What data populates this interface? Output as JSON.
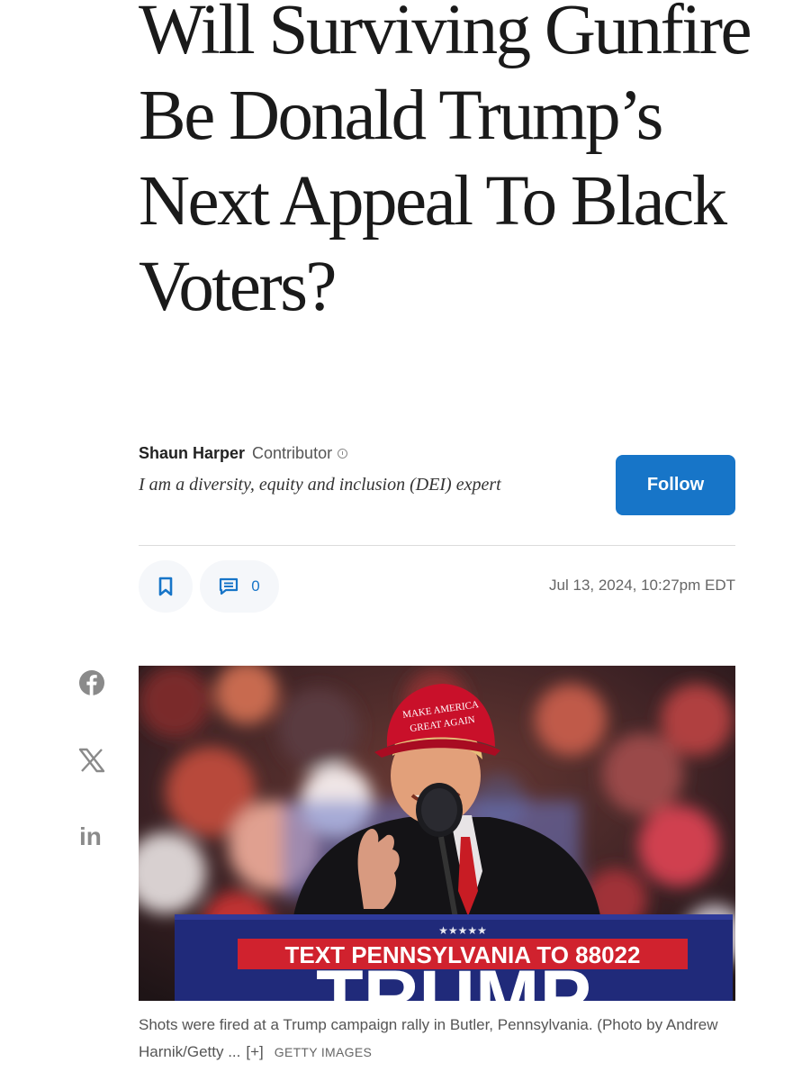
{
  "article": {
    "headline": "Will Surviving Gunfire Be Donald Trump’s Next Appeal To Black Voters?",
    "author_name": "Shaun Harper",
    "author_role": "Contributor",
    "author_bio": "I am a diversity, equity and inclusion (DEI) expert",
    "follow_label": "Follow",
    "comment_count": "0",
    "date": "Jul 13, 2024, 10:27pm EDT"
  },
  "photo": {
    "hat_line1": "MAKE AMERICA",
    "hat_line2": "GREAT AGAIN",
    "podium_stars": "★★★★★",
    "podium_text": "TEXT PENNSYLVANIA TO 88022",
    "podium_word": "TRUMP",
    "caption": "Shots were fired at a Trump campaign rally in Butler, Pennsylvania. (Photo by Andrew Harnik/Getty ...",
    "caption_more": "[+]",
    "caption_source": "GETTY IMAGES"
  },
  "share": {
    "icons": [
      "facebook-icon",
      "x-icon",
      "linkedin-icon"
    ],
    "linkedin_glyph": "in"
  },
  "colors": {
    "accent": "#1775c8",
    "icon_gray": "#8a8a8a",
    "divider": "#dcdcdc"
  }
}
